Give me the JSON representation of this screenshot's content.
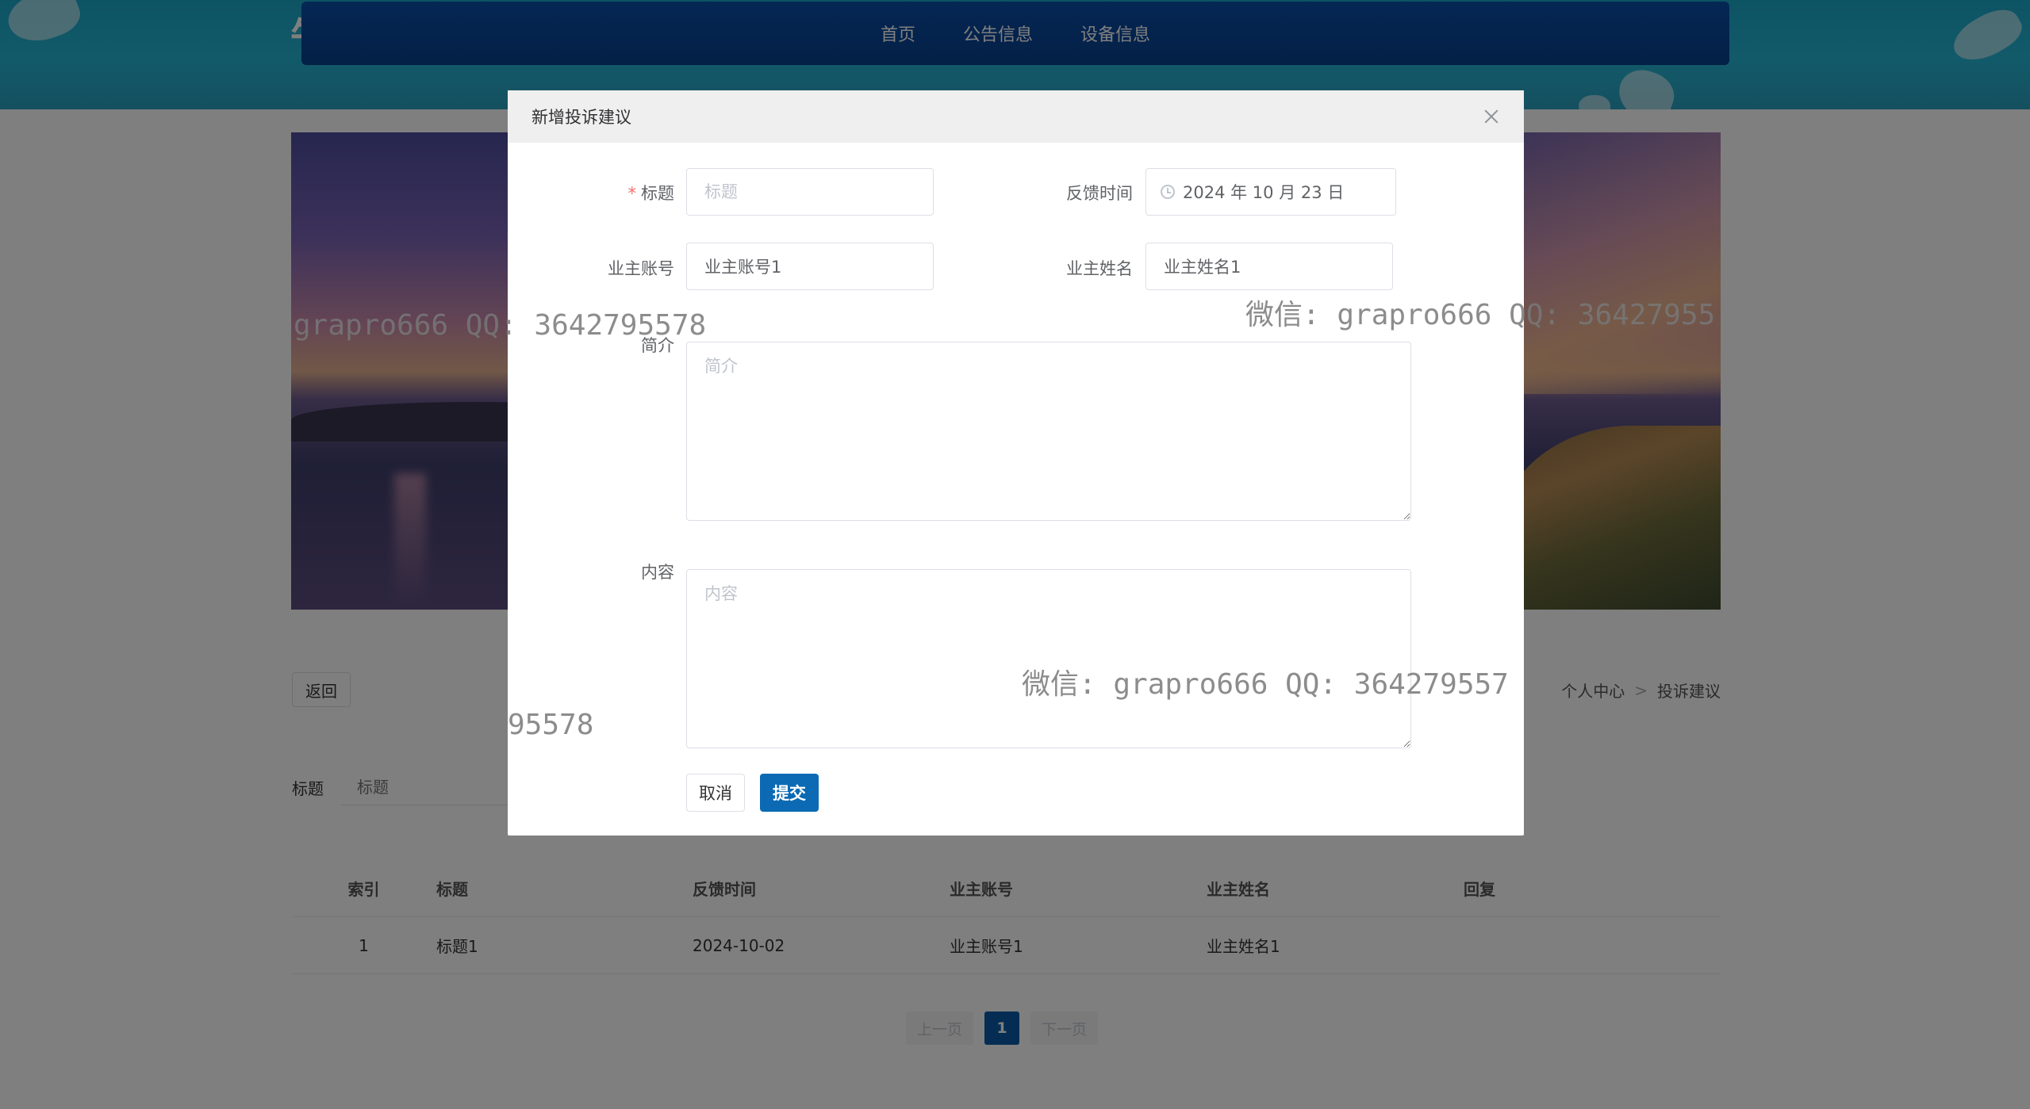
{
  "header": {
    "title_fragment": "牛",
    "nav": [
      "首页",
      "公告信息",
      "设备信息"
    ]
  },
  "page": {
    "back_label": "返回",
    "breadcrumb": [
      "个人中心",
      "投诉建议"
    ],
    "breadcrumb_sep": ">",
    "search": {
      "label": "标题",
      "placeholder": "标题"
    },
    "table": {
      "headers": [
        "索引",
        "标题",
        "反馈时间",
        "业主账号",
        "业主姓名",
        "回复"
      ],
      "rows": [
        [
          "1",
          "标题1",
          "2024-10-02",
          "业主账号1",
          "业主姓名1",
          ""
        ]
      ]
    },
    "pagination": {
      "prev": "上一页",
      "current": "1",
      "next": "下一页"
    }
  },
  "dialog": {
    "title": "新增投诉建议",
    "fields": {
      "title": {
        "label": "标题",
        "required_mark": "*",
        "placeholder": "标题",
        "value": ""
      },
      "feedback_time": {
        "label": "反馈时间",
        "value": "2024 年 10 月 23 日"
      },
      "owner_account": {
        "label": "业主账号",
        "value": "业主账号1"
      },
      "owner_name": {
        "label": "业主姓名",
        "value": "业主姓名1"
      },
      "intro": {
        "label": "简介",
        "placeholder": "简介"
      },
      "content": {
        "label": "内容",
        "placeholder": "内容"
      }
    },
    "cancel_label": "取消",
    "submit_label": "提交"
  },
  "watermarks": [
    "grapro666 QQ: 3642795578",
    "微信: grapro666 QQ: 36427955",
    "微信: grapro666 QQ: 364279557",
    "95578"
  ],
  "colors": {
    "nav_bg": "#073f8c",
    "primary": "#0b6ab3",
    "required": "#f56c6c",
    "header_bg": "#25b5d3"
  }
}
